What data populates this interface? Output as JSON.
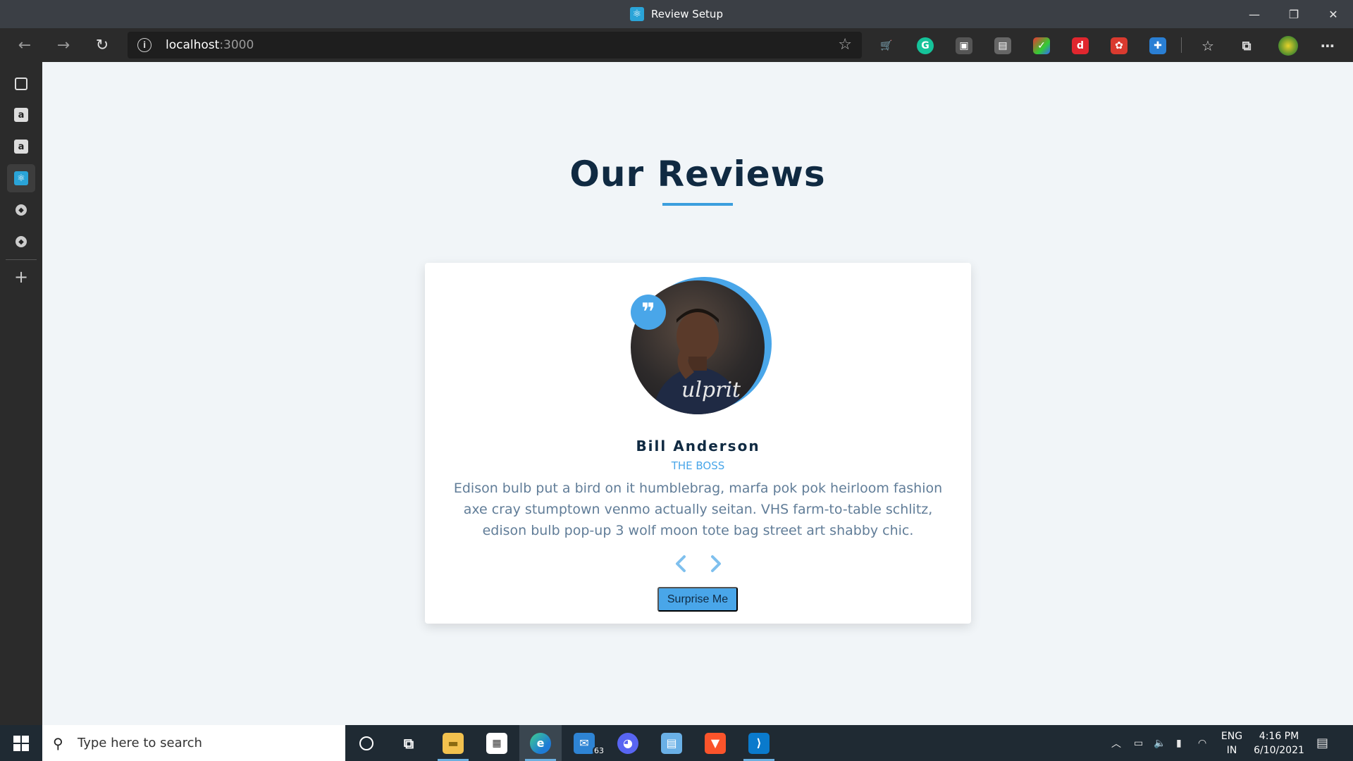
{
  "window": {
    "title": "Review Setup",
    "controls": [
      "minimize",
      "restore",
      "close"
    ]
  },
  "browser": {
    "url_host": "localhost",
    "url_port": ":3000",
    "nav": [
      "back-icon",
      "forward-icon",
      "refresh-icon"
    ],
    "extensions": [
      "shopping-cart-icon",
      "grammarly-icon",
      "extension-icon",
      "extension-icon",
      "extension-icon",
      "extension-icon",
      "extension-icon",
      "extension-icon",
      "favorites-icon",
      "collections-icon",
      "profile-avatar",
      "more-icon"
    ]
  },
  "sidebar": {
    "items": [
      "tab-icon",
      "amazon-icon",
      "amazon-icon",
      "react-icon",
      "app-icon",
      "app-icon",
      "add-icon"
    ]
  },
  "page": {
    "heading": "Our Reviews",
    "review": {
      "name": "Bill Anderson",
      "job": "THE BOSS",
      "text": "Edison bulb put a bird on it humblebrag, marfa pok pok heirloom fashion axe cray stumptown venmo actually seitan. VHS farm-to-table schlitz, edison bulb pop-up 3 wolf moon tote bag street art shabby chic."
    },
    "prev_label": "‹",
    "next_label": "›",
    "surprise_label": "Surprise Me"
  },
  "taskbar": {
    "search_placeholder": "Type here to search",
    "mail_badge": "63",
    "language": "ENG",
    "region": "IN",
    "time": "4:16 PM",
    "date": "6/10/2021"
  },
  "colors": {
    "accent": "#49a6e9",
    "heading": "#102a42",
    "text": "#617d98",
    "page_bg": "#f1f5f8"
  }
}
